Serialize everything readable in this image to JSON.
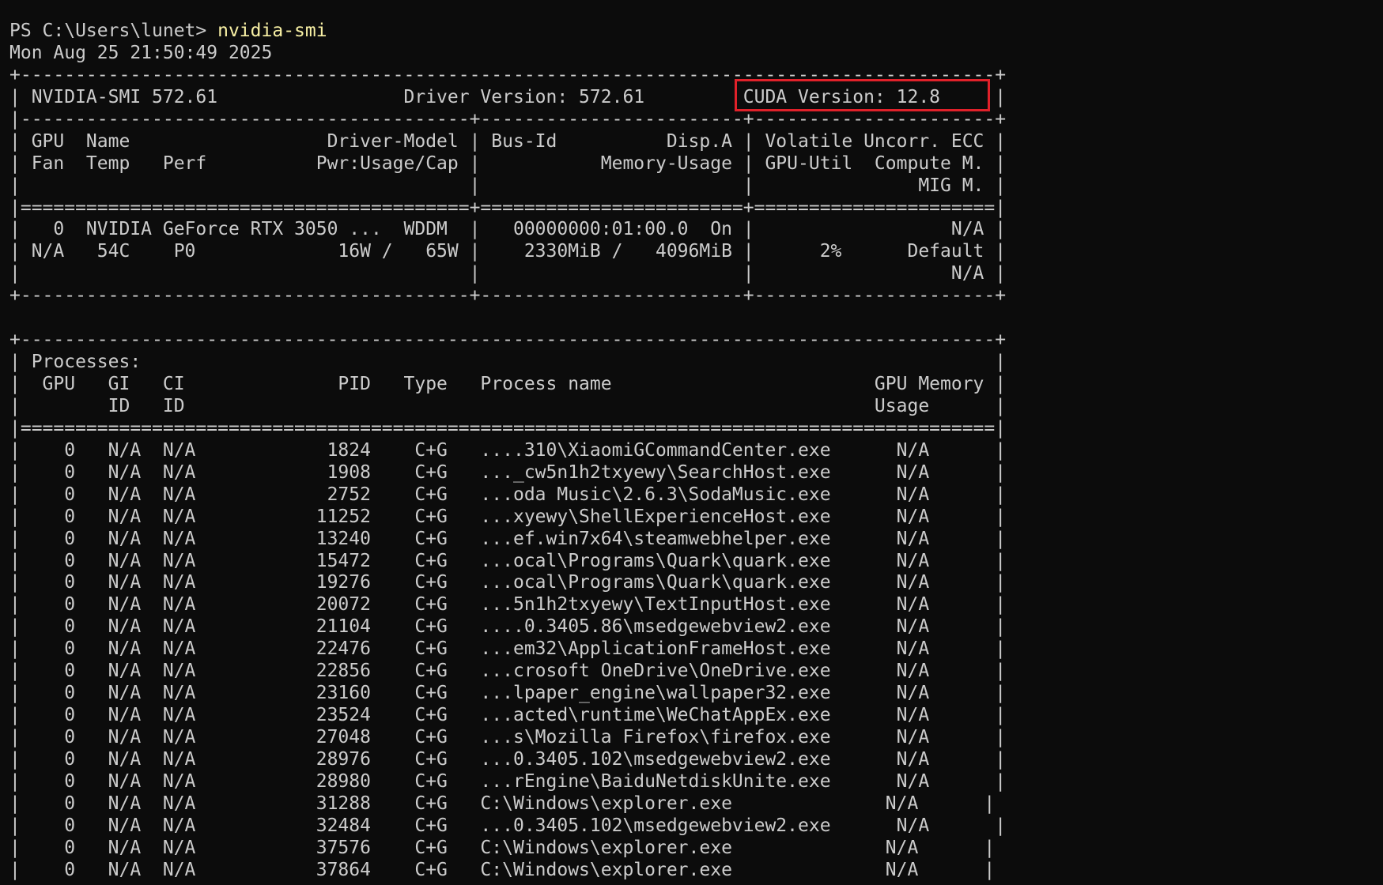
{
  "prompt": {
    "path": "PS C:\\Users\\lunet> ",
    "command": "nvidia-smi"
  },
  "timestamp": "Mon Aug 25 21:50:49 2025",
  "header_lines": [
    "+-----------------------------------------------------------------------------------------+",
    "| NVIDIA-SMI 572.61                 Driver Version: 572.61         CUDA Version: 12.8     |",
    "|-----------------------------------------+------------------------+----------------------+",
    "| GPU  Name                  Driver-Model | Bus-Id          Disp.A | Volatile Uncorr. ECC |",
    "| Fan  Temp   Perf          Pwr:Usage/Cap |           Memory-Usage | GPU-Util  Compute M. |",
    "|                                         |                        |               MIG M. |",
    "|=========================================+========================+======================|",
    "|   0  NVIDIA GeForce RTX 3050 ...  WDDM  |   00000000:01:00.0  On |                  N/A |",
    "| N/A   54C    P0             16W /   65W |    2330MiB /   4096MiB |      2%      Default |",
    "|                                         |                        |                  N/A |",
    "+-----------------------------------------+------------------------+----------------------+"
  ],
  "blank_line": "",
  "process_header_lines": [
    "+-----------------------------------------------------------------------------------------+",
    "| Processes:                                                                              |",
    "|  GPU   GI   CI              PID   Type   Process name                        GPU Memory |",
    "|        ID   ID                                                               Usage      |",
    "|=========================================================================================|"
  ],
  "process_rows": [
    "|    0   N/A  N/A            1824    C+G   ....310\\XiaomiGCommandCenter.exe      N/A      |",
    "|    0   N/A  N/A            1908    C+G   ..._cw5n1h2txyewy\\SearchHost.exe      N/A      |",
    "|    0   N/A  N/A            2752    C+G   ...oda Music\\2.6.3\\SodaMusic.exe      N/A      |",
    "|    0   N/A  N/A           11252    C+G   ...xyewy\\ShellExperienceHost.exe      N/A      |",
    "|    0   N/A  N/A           13240    C+G   ...ef.win7x64\\steamwebhelper.exe      N/A      |",
    "|    0   N/A  N/A           15472    C+G   ...ocal\\Programs\\Quark\\quark.exe      N/A      |",
    "|    0   N/A  N/A           19276    C+G   ...ocal\\Programs\\Quark\\quark.exe      N/A      |",
    "|    0   N/A  N/A           20072    C+G   ...5n1h2txyewy\\TextInputHost.exe      N/A      |",
    "|    0   N/A  N/A           21104    C+G   ....0.3405.86\\msedgewebview2.exe      N/A      |",
    "|    0   N/A  N/A           22476    C+G   ...em32\\ApplicationFrameHost.exe      N/A      |",
    "|    0   N/A  N/A           22856    C+G   ...crosoft OneDrive\\OneDrive.exe      N/A      |",
    "|    0   N/A  N/A           23160    C+G   ...lpaper_engine\\wallpaper32.exe      N/A      |",
    "|    0   N/A  N/A           23524    C+G   ...acted\\runtime\\WeChatAppEx.exe      N/A      |",
    "|    0   N/A  N/A           27048    C+G   ...s\\Mozilla Firefox\\firefox.exe      N/A      |",
    "|    0   N/A  N/A           28976    C+G   ...0.3405.102\\msedgewebview2.exe      N/A      |",
    "|    0   N/A  N/A           28980    C+G   ...rEngine\\BaiduNetdiskUnite.exe      N/A      |",
    "|    0   N/A  N/A           31288    C+G   C:\\Windows\\explorer.exe              N/A      |",
    "|    0   N/A  N/A           32484    C+G   ...0.3405.102\\msedgewebview2.exe      N/A      |",
    "|    0   N/A  N/A           37576    C+G   C:\\Windows\\explorer.exe              N/A      |",
    "|    0   N/A  N/A           37864    C+G   C:\\Windows\\explorer.exe              N/A      |"
  ],
  "colors": {
    "background": "#0c0c0c",
    "text": "#cccccc",
    "command": "#f9f1a5",
    "highlight_box": "#e0212a"
  }
}
